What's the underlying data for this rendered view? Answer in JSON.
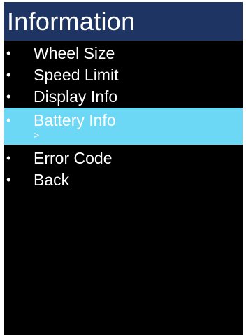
{
  "header": {
    "title": "Information"
  },
  "menu": {
    "bullet": "•",
    "items": [
      {
        "label": "Wheel Size"
      },
      {
        "label": "Speed Limit"
      },
      {
        "label": "Display Info"
      },
      {
        "label": "Battery Info",
        "selected": true,
        "indicator": ">"
      },
      {
        "label": "Error Code"
      },
      {
        "label": "Back"
      }
    ]
  },
  "colors": {
    "background": "#000000",
    "header": "#1e3463",
    "selection": "#6dd8f5",
    "text": "#ffffff"
  }
}
